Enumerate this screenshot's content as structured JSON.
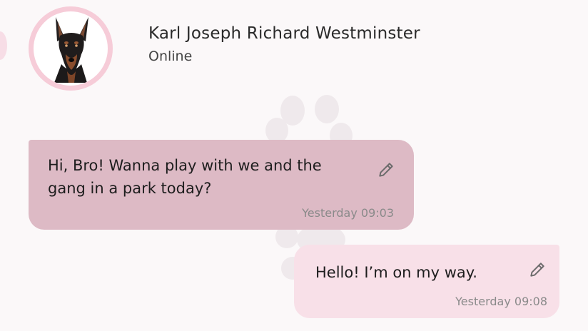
{
  "contact": {
    "name": "Karl Joseph Richard Westminster",
    "status": "Online",
    "avatar_icon": "doberman-avatar"
  },
  "messages": [
    {
      "direction": "incoming",
      "text": "Hi, Bro! Wanna play with we and the gang in a park today?",
      "time": "Yesterday 09:03",
      "action_icon": "pencil-icon"
    },
    {
      "direction": "outgoing",
      "text": "Hello! I’m on my way.",
      "time": "Yesterday 09:08",
      "action_icon": "pencil-icon"
    }
  ],
  "colors": {
    "background": "#fbf8f9",
    "avatar_ring": "#f6ccd8",
    "incoming_bubble": "#ddbac5",
    "outgoing_bubble": "#f8e0e8",
    "timestamp": "#8a8a8a"
  }
}
